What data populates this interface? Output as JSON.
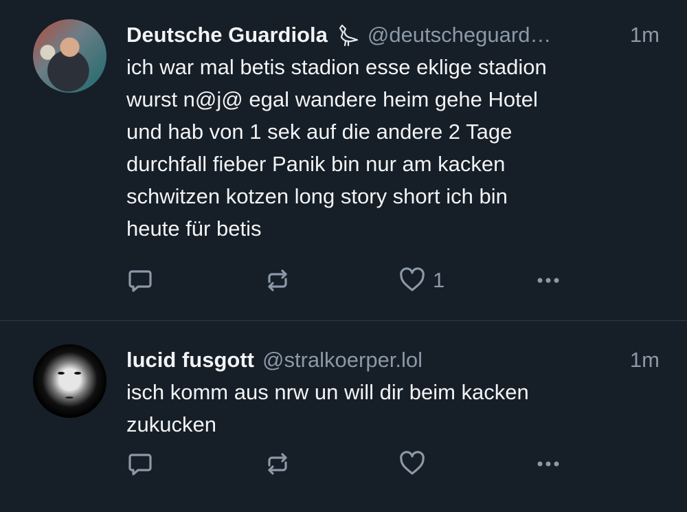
{
  "posts": [
    {
      "display_name": "Deutsche Guardiola",
      "handle": "@deutscheguard…",
      "time": "1m",
      "text": "ich war mal betis stadion esse eklige stadion\nwurst n@j@ egal wandere heim gehe Hotel\nund hab von 1 sek auf die andere 2 Tage\ndurchfall fieber Panik bin nur am kacken\nschwitzen kotzen long story short ich bin\nheute für betis",
      "like_count": "1",
      "icons": [
        "bird-icon",
        "reply-icon",
        "repost-icon",
        "heart-icon",
        "more-icon"
      ]
    },
    {
      "display_name": "lucid fusgott",
      "handle": "@stralkoerper.lol",
      "time": "1m",
      "text": "isch komm aus nrw un will dir beim kacken\nzukucken",
      "like_count": "",
      "icons": [
        "reply-icon",
        "repost-icon",
        "heart-icon",
        "more-icon"
      ]
    }
  ],
  "colors": {
    "background": "#161e27",
    "text": "#f1f3f5",
    "muted": "#8b99a8",
    "divider": "#2e3a48"
  }
}
